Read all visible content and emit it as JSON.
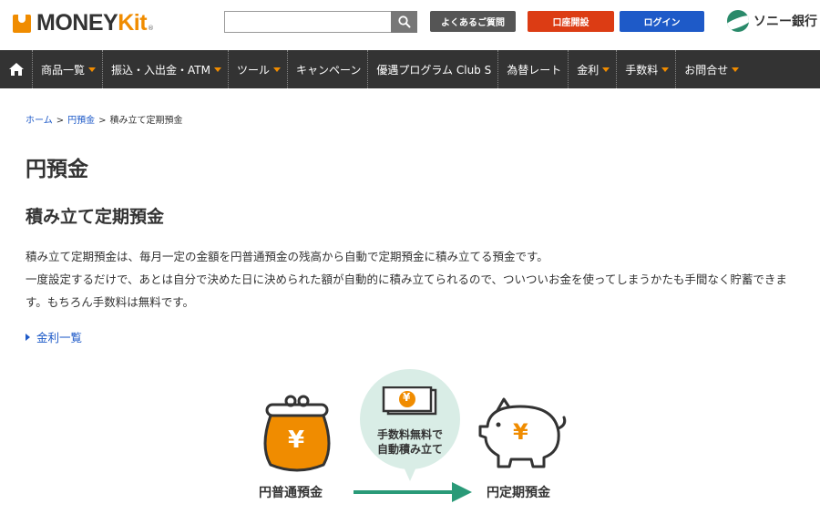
{
  "header": {
    "logo_text_main": "MONEY",
    "logo_text_kit": "Kit",
    "logo_reg": "®",
    "search_placeholder": "",
    "faq_label": "よくあるご質問",
    "open_account_label": "口座開設",
    "login_label": "ログイン",
    "bank_name": "ソニー銀行"
  },
  "nav": {
    "items": [
      {
        "label": "商品一覧",
        "dropdown": true
      },
      {
        "label": "振込・入出金・ATM",
        "dropdown": true
      },
      {
        "label": "ツール",
        "dropdown": true
      },
      {
        "label": "キャンペーン",
        "dropdown": false
      },
      {
        "label": "優遇プログラム Club S",
        "dropdown": false
      },
      {
        "label": "為替レート",
        "dropdown": false
      },
      {
        "label": "金利",
        "dropdown": true
      },
      {
        "label": "手数料",
        "dropdown": true
      },
      {
        "label": "お問合せ",
        "dropdown": true
      }
    ]
  },
  "breadcrumb": {
    "home": "ホーム",
    "sep": ">",
    "parent": "円預金",
    "current": "積み立て定期預金"
  },
  "main": {
    "page_title": "円預金",
    "section_title": "積み立て定期預金",
    "paragraph_1": "積み立て定期預金は、毎月一定の金額を円普通預金の残高から自動で定期預金に積み立てる預金です。",
    "paragraph_2": "一度設定するだけで、あとは自分で決めた日に決められた額が自動的に積み立てられるので、ついついお金を使ってしまうかたも手間なく貯蓄できます。もちろん手数料は無料です。",
    "rate_link": "金利一覧"
  },
  "illustration": {
    "left_label": "円普通預金",
    "right_label": "円定期預金",
    "bubble_line_1": "手数料無料で",
    "bubble_line_2": "自動積み立て",
    "yen_symbol": "¥"
  },
  "colors": {
    "accent_orange": "#f08c00",
    "nav_bg": "#333333",
    "link_blue": "#1e5ac8",
    "open_red": "#dc3c14",
    "arrow_green": "#2a9a78",
    "bubble_bg": "#d9ede6"
  },
  "icons": [
    "search-icon",
    "home-icon",
    "chevron-down-icon",
    "triangle-right-icon",
    "purse-icon",
    "bills-icon",
    "piggy-bank-icon",
    "arrow-right-icon"
  ]
}
